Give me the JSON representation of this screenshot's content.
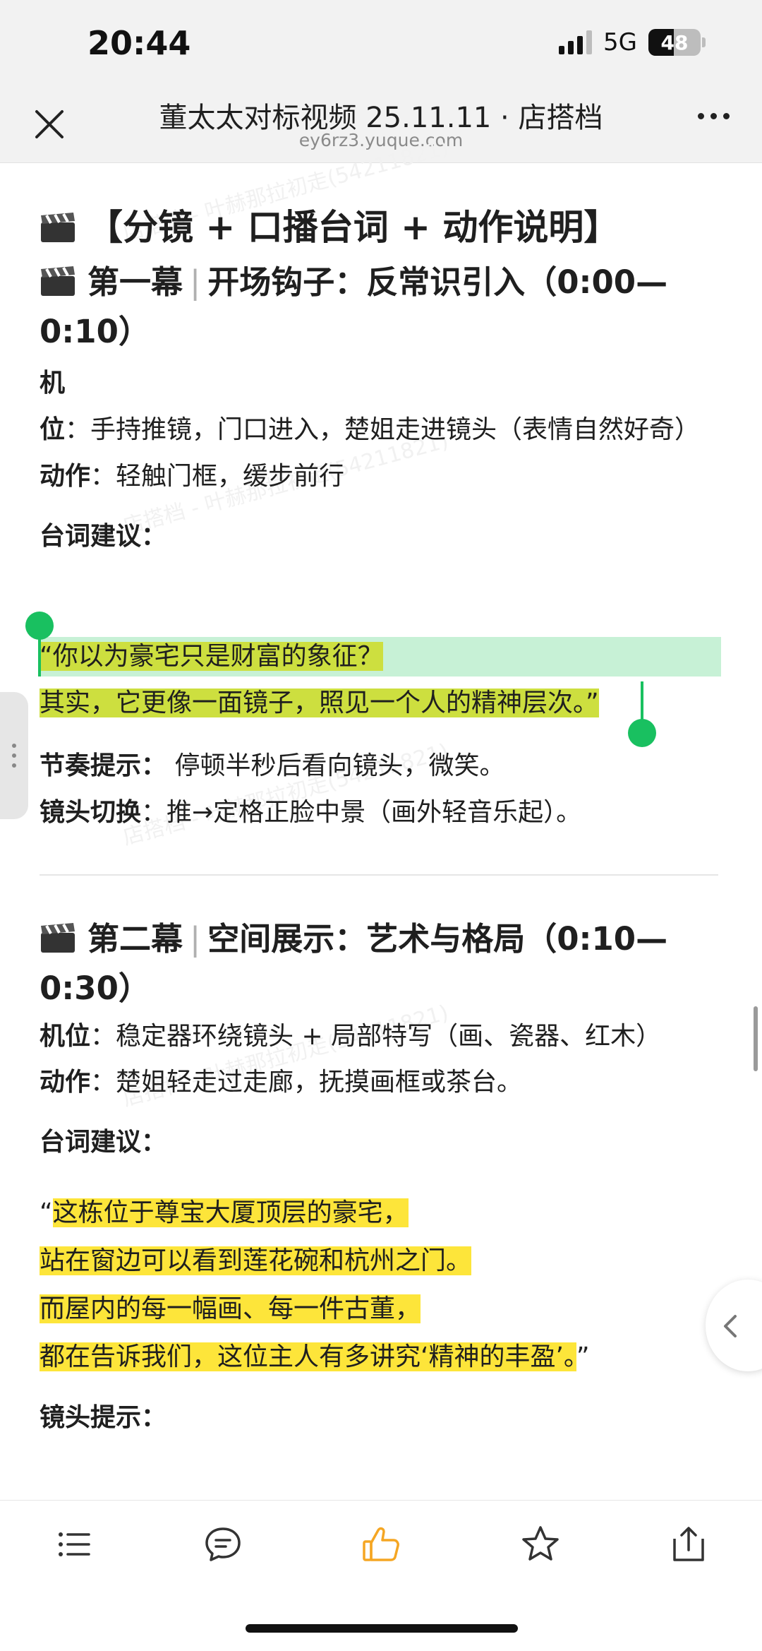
{
  "status_bar": {
    "time": "20:44",
    "network": "5G",
    "battery": "48",
    "battery_level": 0.48
  },
  "nav": {
    "title": "董太太对标视频 25.11.11 · 店搭档",
    "subtitle": "ey6rz3.yuque.com"
  },
  "doc": {
    "heading": "【分镜 + 口播台词 + 动作说明】",
    "scene1": {
      "title": "第一幕",
      "subtitle": "开场钩子：反常识引入（0:00—0:10）",
      "camera_label": "机位",
      "camera_text": "：手持推镜，门口进入，楚姐走进镜头（表情自然好奇）",
      "action_label": "动作",
      "action_text": "：轻触门框，缓步前行",
      "lines_label": "台词建议：",
      "quote_open": "“",
      "quote_line1": "你以为豪宅只是财富的象征？",
      "quote_line2": "其实，它更像一面镜子，照见一个人的精神层次。",
      "quote_close": "”",
      "rhythm_label": "节奏提示：",
      "rhythm_text": " 停顿半秒后看向镜头，微笑。",
      "cut_label": "镜头切换",
      "cut_text": "：推→定格正脸中景（画外轻音乐起）。"
    },
    "scene2": {
      "title": "第二幕",
      "subtitle": "空间展示：艺术与格局（0:10—0:30）",
      "camera_label": "机位",
      "camera_text": "：稳定器环绕镜头 + 局部特写（画、瓷器、红木）",
      "action_label": "动作",
      "action_text": "：楚姐轻走过走廊，抚摸画框或茶台。",
      "lines_label": "台词建议：",
      "quote_open": "“",
      "quote_line1": "这栋位于尊宝大厦顶层的豪宅，",
      "quote_line2": "站在窗边可以看到莲花碗和杭州之门。",
      "quote_line3": "而屋内的每一幅画、每一件古董，",
      "quote_line4": "都在告诉我们，这位主人有多讲究‘精神的丰盈’。",
      "quote_close": "”",
      "shot_label": "镜头提示："
    }
  },
  "watermark": "店搭档 - 叶赫那拉初走(54211821)",
  "toolbar": {
    "items": [
      "outline-icon",
      "comment-icon",
      "like-icon",
      "favorite-icon",
      "share-icon"
    ]
  },
  "colors": {
    "like": "#f5a623",
    "highlight_yellow": "#fde53a",
    "highlight_green": "#cddf3f",
    "selection": "#c7f1d6",
    "handle": "#19c060"
  }
}
